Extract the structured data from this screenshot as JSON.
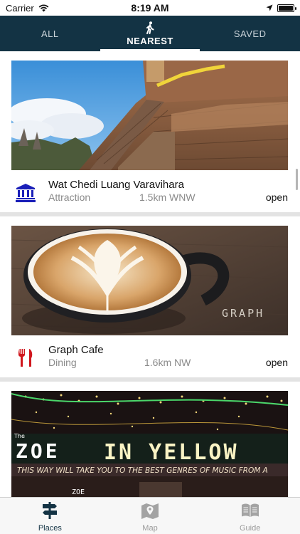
{
  "status_bar": {
    "carrier": "Carrier",
    "time": "8:19 AM",
    "battery_level": 1.0
  },
  "top_tabs": [
    {
      "label": "ALL",
      "active": false
    },
    {
      "label": "NEAREST",
      "active": true,
      "icon": "walking-person-icon"
    },
    {
      "label": "SAVED",
      "active": false
    }
  ],
  "places": [
    {
      "title": "Wat Chedi Luang Varavihara",
      "category": "Attraction",
      "distance": "1.5km WNW",
      "status": "open",
      "icon": "museum-icon",
      "icon_color": "#1a1fb8"
    },
    {
      "title": "Graph Cafe",
      "category": "Dining",
      "distance": "1.6km NW",
      "status": "open",
      "icon": "fork-knife-icon",
      "icon_color": "#d0161d"
    },
    {
      "image_text": {
        "the": "The",
        "name_left": "ZOE",
        "name_right": "IN YELLOW",
        "banner": "THIS WAY WILL TAKE YOU TO THE BEST GENRES OF MUSIC FROM A",
        "small_sign": "ZOE"
      }
    }
  ],
  "cafe_image_text": "GRAPH",
  "bottom_tabs": [
    {
      "label": "Places",
      "icon": "signpost-icon",
      "active": true
    },
    {
      "label": "Map",
      "icon": "map-pin-icon",
      "active": false
    },
    {
      "label": "Guide",
      "icon": "book-icon",
      "active": false
    }
  ],
  "colors": {
    "header": "#133344",
    "divider": "#e3e3e3",
    "active_tab": "#133344",
    "inactive_tab": "#9a9a9a"
  }
}
